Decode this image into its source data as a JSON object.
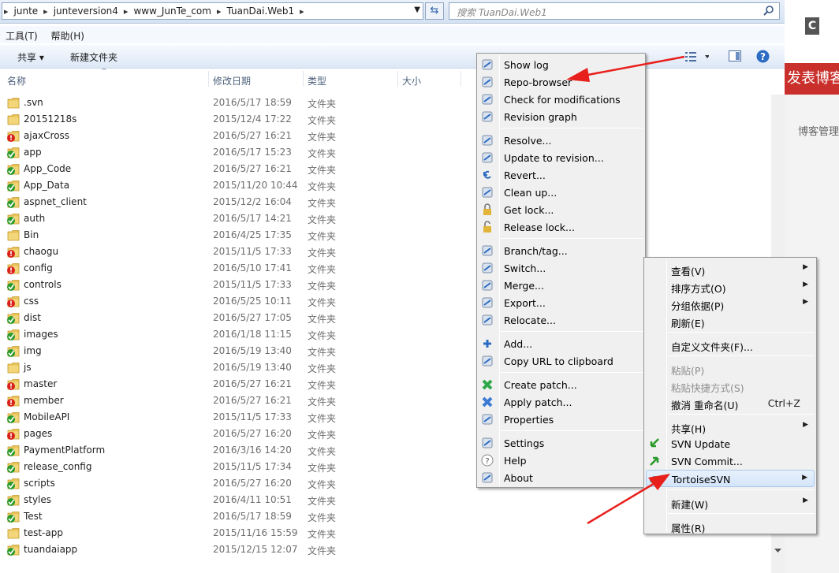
{
  "address_bar": {
    "crumbs": [
      "junte",
      "junteversion4",
      "www_JunTe_com",
      "TuanDai.Web1"
    ],
    "search_placeholder": "搜索 TuanDai.Web1"
  },
  "menubar": {
    "tools": "工具(T)",
    "help": "帮助(H)"
  },
  "command_bar": {
    "share": "共享 ▾",
    "new_folder": "新建文件夹"
  },
  "columns": {
    "name": "名称",
    "modified": "修改日期",
    "type": "类型",
    "size": "大小"
  },
  "files": [
    {
      "name": ".svn",
      "date": "2016/5/17 18:59",
      "type": "文件夹",
      "status": "plain"
    },
    {
      "name": "20151218s",
      "date": "2015/12/4 17:22",
      "type": "文件夹",
      "status": "plain"
    },
    {
      "name": "ajaxCross",
      "date": "2016/5/27 16:21",
      "type": "文件夹",
      "status": "modified"
    },
    {
      "name": "app",
      "date": "2016/5/17 15:23",
      "type": "文件夹",
      "status": "normal"
    },
    {
      "name": "App_Code",
      "date": "2016/5/27 16:21",
      "type": "文件夹",
      "status": "normal"
    },
    {
      "name": "App_Data",
      "date": "2015/11/20 10:44",
      "type": "文件夹",
      "status": "normal"
    },
    {
      "name": "aspnet_client",
      "date": "2015/12/2 16:04",
      "type": "文件夹",
      "status": "normal"
    },
    {
      "name": "auth",
      "date": "2016/5/17 14:21",
      "type": "文件夹",
      "status": "normal"
    },
    {
      "name": "Bin",
      "date": "2016/4/25 17:35",
      "type": "文件夹",
      "status": "plain"
    },
    {
      "name": "chaogu",
      "date": "2015/11/5 17:33",
      "type": "文件夹",
      "status": "modified"
    },
    {
      "name": "config",
      "date": "2016/5/10 17:41",
      "type": "文件夹",
      "status": "modified"
    },
    {
      "name": "controls",
      "date": "2015/11/5 17:33",
      "type": "文件夹",
      "status": "normal"
    },
    {
      "name": "css",
      "date": "2016/5/25 10:11",
      "type": "文件夹",
      "status": "modified"
    },
    {
      "name": "dist",
      "date": "2016/5/27 17:05",
      "type": "文件夹",
      "status": "normal"
    },
    {
      "name": "images",
      "date": "2016/1/18 11:15",
      "type": "文件夹",
      "status": "normal"
    },
    {
      "name": "img",
      "date": "2016/5/19 13:40",
      "type": "文件夹",
      "status": "normal"
    },
    {
      "name": "js",
      "date": "2016/5/19 13:40",
      "type": "文件夹",
      "status": "plain"
    },
    {
      "name": "master",
      "date": "2016/5/27 16:21",
      "type": "文件夹",
      "status": "modified"
    },
    {
      "name": "member",
      "date": "2016/5/27 16:21",
      "type": "文件夹",
      "status": "modified"
    },
    {
      "name": "MobileAPI",
      "date": "2015/11/5 17:33",
      "type": "文件夹",
      "status": "normal"
    },
    {
      "name": "pages",
      "date": "2016/5/27 16:20",
      "type": "文件夹",
      "status": "modified"
    },
    {
      "name": "PaymentPlatform",
      "date": "2016/3/16 14:20",
      "type": "文件夹",
      "status": "normal"
    },
    {
      "name": "release_config",
      "date": "2015/11/5 17:34",
      "type": "文件夹",
      "status": "normal"
    },
    {
      "name": "scripts",
      "date": "2016/5/27 16:20",
      "type": "文件夹",
      "status": "normal"
    },
    {
      "name": "styles",
      "date": "2016/4/11 10:51",
      "type": "文件夹",
      "status": "normal"
    },
    {
      "name": "Test",
      "date": "2016/5/17 18:59",
      "type": "文件夹",
      "status": "normal"
    },
    {
      "name": "test-app",
      "date": "2015/11/16 15:59",
      "type": "文件夹",
      "status": "plain"
    },
    {
      "name": "tuandaiapp",
      "date": "2015/12/15 12:07",
      "type": "文件夹",
      "status": "normal"
    }
  ],
  "svn_menu": [
    [
      {
        "label": "Show log",
        "icon": "show-log-icon"
      },
      {
        "label": "Repo-browser",
        "icon": "repo-browser-icon"
      },
      {
        "label": "Check for modifications",
        "icon": "check-modifications-icon"
      },
      {
        "label": "Revision graph",
        "icon": "revision-graph-icon"
      }
    ],
    [
      {
        "label": "Resolve...",
        "icon": "resolve-icon"
      },
      {
        "label": "Update to revision...",
        "icon": "update-revision-icon"
      },
      {
        "label": "Revert...",
        "icon": "revert-icon"
      },
      {
        "label": "Clean up...",
        "icon": "cleanup-icon"
      },
      {
        "label": "Get lock...",
        "icon": "lock-icon"
      },
      {
        "label": "Release lock...",
        "icon": "unlock-icon"
      }
    ],
    [
      {
        "label": "Branch/tag...",
        "icon": "branch-icon"
      },
      {
        "label": "Switch...",
        "icon": "switch-icon"
      },
      {
        "label": "Merge...",
        "icon": "merge-icon"
      },
      {
        "label": "Export...",
        "icon": "export-icon"
      },
      {
        "label": "Relocate...",
        "icon": "relocate-icon"
      }
    ],
    [
      {
        "label": "Add...",
        "icon": "add-icon"
      },
      {
        "label": "Copy URL to clipboard",
        "icon": "copy-url-icon"
      }
    ],
    [
      {
        "label": "Create patch...",
        "icon": "create-patch-icon"
      },
      {
        "label": "Apply patch...",
        "icon": "apply-patch-icon"
      },
      {
        "label": "Properties",
        "icon": "properties-icon"
      }
    ],
    [
      {
        "label": "Settings",
        "icon": "settings-icon"
      },
      {
        "label": "Help",
        "icon": "help-icon"
      },
      {
        "label": "About",
        "icon": "about-icon"
      }
    ]
  ],
  "context_menu": [
    [
      {
        "label": "查看(V)",
        "submenu": true
      },
      {
        "label": "排序方式(O)",
        "submenu": true
      },
      {
        "label": "分组依据(P)",
        "submenu": true
      },
      {
        "label": "刷新(E)"
      }
    ],
    [
      {
        "label": "自定义文件夹(F)..."
      }
    ],
    [
      {
        "label": "粘贴(P)",
        "disabled": true
      },
      {
        "label": "粘贴快捷方式(S)",
        "disabled": true
      },
      {
        "label": "撤消 重命名(U)",
        "shortcut": "Ctrl+Z"
      }
    ],
    [
      {
        "label": "共享(H)",
        "submenu": true
      },
      {
        "label": "SVN Update",
        "icon": "svn-update-icon"
      },
      {
        "label": "SVN Commit...",
        "icon": "svn-commit-icon"
      },
      {
        "label": "TortoiseSVN",
        "icon": "tortoisesvn-icon",
        "submenu": true,
        "highlighted": true
      }
    ],
    [
      {
        "label": "新建(W)",
        "submenu": true
      }
    ],
    [
      {
        "label": "属性(R)"
      }
    ]
  ],
  "background_page": {
    "banner": "发表博客",
    "manage": "博客管理"
  },
  "accent_colors": {
    "arrow": "#e8201c",
    "banner": "#c9302c",
    "highlight": "#d4e5fa"
  }
}
